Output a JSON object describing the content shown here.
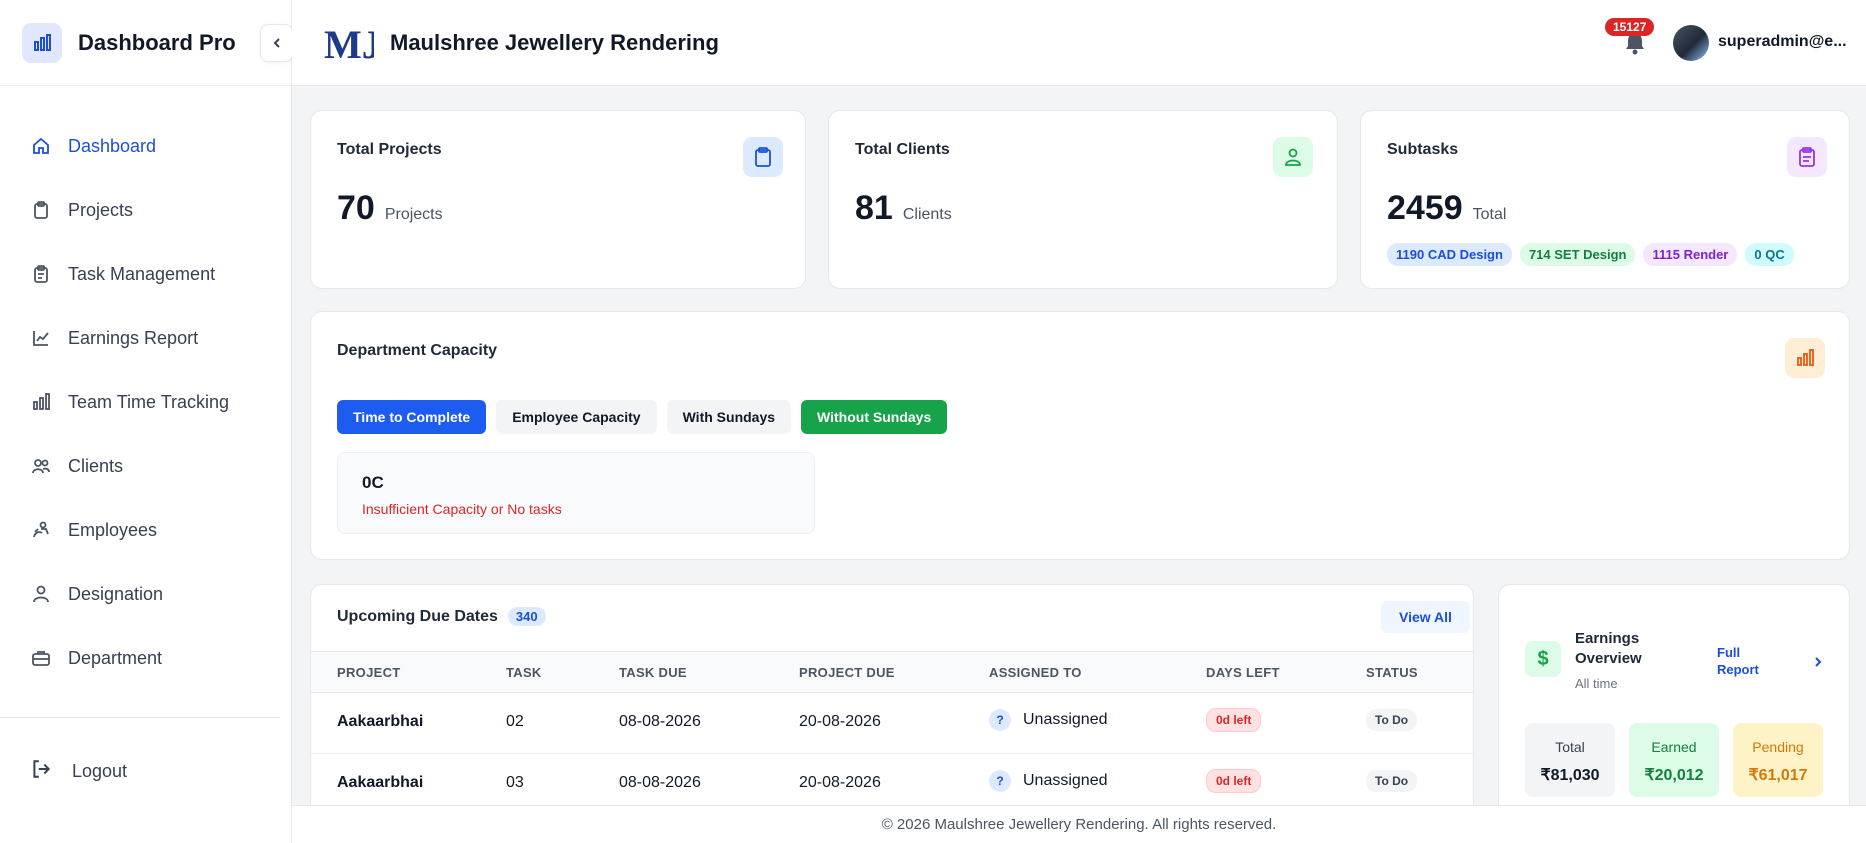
{
  "sidebar": {
    "brand_title": "Dashboard Pro",
    "items": [
      {
        "label": "Dashboard",
        "icon": "home-icon"
      },
      {
        "label": "Projects",
        "icon": "clipboard-icon"
      },
      {
        "label": "Task Management",
        "icon": "clipboard-list-icon"
      },
      {
        "label": "Earnings Report",
        "icon": "line-chart-icon"
      },
      {
        "label": "Team Time Tracking",
        "icon": "bar-chart-icon"
      },
      {
        "label": "Clients",
        "icon": "users-icon"
      },
      {
        "label": "Employees",
        "icon": "user-group-icon"
      },
      {
        "label": "Designation",
        "icon": "user-icon"
      },
      {
        "label": "Department",
        "icon": "briefcase-icon"
      }
    ],
    "logout_label": "Logout"
  },
  "header": {
    "logo_text": "MJ",
    "company": "Maulshree Jewellery Rendering",
    "notification_count": "15127",
    "user": "superadmin@e..."
  },
  "stats": {
    "projects": {
      "title": "Total Projects",
      "value": "70",
      "unit": "Projects"
    },
    "clients": {
      "title": "Total Clients",
      "value": "81",
      "unit": "Clients"
    },
    "subtasks": {
      "title": "Subtasks",
      "value": "2459",
      "unit": "Total",
      "chips": [
        "1190 CAD Design",
        "714 SET Design",
        "1115 Render",
        "0 QC"
      ]
    }
  },
  "department": {
    "title": "Department Capacity",
    "tabs": [
      "Time to Complete",
      "Employee Capacity",
      "With Sundays",
      "Without Sundays"
    ],
    "capacity_value": "0C",
    "capacity_message": "Insufficient Capacity or No tasks"
  },
  "upcoming": {
    "title": "Upcoming Due Dates",
    "count": "340",
    "view_all": "View All",
    "columns": [
      "PROJECT",
      "TASK",
      "TASK DUE",
      "PROJECT DUE",
      "ASSIGNED TO",
      "DAYS LEFT",
      "STATUS"
    ],
    "rows": [
      {
        "project": "Aakaarbhai",
        "task": "02",
        "task_due": "08-08-2026",
        "project_due": "20-08-2026",
        "assigned_mark": "?",
        "assigned": "Unassigned",
        "days_left": "0d left",
        "status": "To Do"
      },
      {
        "project": "Aakaarbhai",
        "task": "03",
        "task_due": "08-08-2026",
        "project_due": "20-08-2026",
        "assigned_mark": "?",
        "assigned": "Unassigned",
        "days_left": "0d left",
        "status": "To Do"
      }
    ]
  },
  "earnings": {
    "icon_symbol": "$",
    "title": "Earnings Overview",
    "subtitle": "All time",
    "full_report": "Full Report",
    "total_label": "Total",
    "total": "₹81,030",
    "earned_label": "Earned",
    "earned": "₹20,012",
    "pending_label": "Pending",
    "pending": "₹61,017"
  },
  "footer": "© 2026 Maulshree Jewellery Rendering. All rights reserved.",
  "colors": {
    "primary": "#1d4ed8",
    "tab_active": "#1d5cf0",
    "tab_green": "#16a34a",
    "danger": "#dc2626"
  }
}
